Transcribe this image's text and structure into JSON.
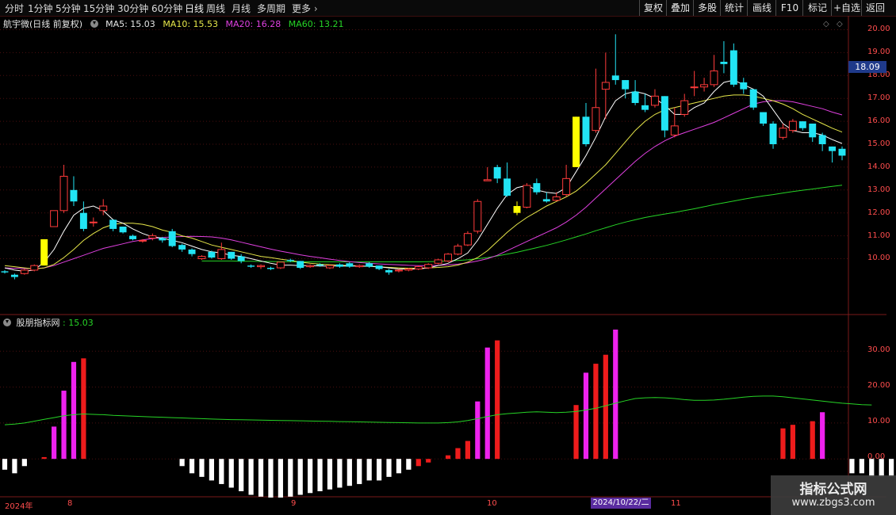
{
  "toolbar": {
    "periods": [
      "分时",
      "1分钟",
      "5分钟",
      "15分钟",
      "30分钟",
      "60分钟",
      "日线",
      "周线",
      "月线",
      "多周期",
      "更多"
    ],
    "active_period": "日线",
    "tools": [
      "复权",
      "叠加",
      "多股",
      "统计",
      "画线",
      "F10",
      "标记",
      "+自选",
      "返回"
    ]
  },
  "main_chart": {
    "stock_label": "航宇微(日线 前复权)",
    "ma5": "MA5: 15.03",
    "ma10": "MA10: 15.53",
    "ma20": "MA20: 16.28",
    "ma60": "MA60: 13.21",
    "current_price_tag": "18.09",
    "y_labels": [
      "20.00",
      "19.00",
      "18.00",
      "17.00",
      "16.00",
      "15.00",
      "14.00",
      "13.00",
      "12.00",
      "11.00",
      "10.00"
    ],
    "colors": {
      "up": "#ff3b3b",
      "down": "#22e4f4",
      "ma5": "#ffffff",
      "ma10": "#e8e84a",
      "ma20": "#e040e0",
      "ma60": "#26d426",
      "highlight": "#ffff00"
    }
  },
  "indicator": {
    "name": "股朋指标网",
    "value": ": 15.03",
    "y_labels": [
      "30.00",
      "20.00",
      "10.00",
      "0.00"
    ]
  },
  "date_axis": {
    "labels": [
      "2024年",
      "8",
      "9",
      "10",
      "11"
    ],
    "highlighted": "2024/10/22/二"
  },
  "watermark": {
    "title": "指标公式网",
    "url": "www.zbgs3.com"
  },
  "chart_data": {
    "type": "candlestick",
    "title": "航宇微(日线 前复权)",
    "y_range": [
      9.0,
      20.3
    ],
    "candles": [
      [
        9.45,
        9.4,
        9.5,
        9.35
      ],
      [
        9.3,
        9.2,
        9.35,
        9.1
      ],
      [
        9.35,
        9.5,
        9.55,
        9.3
      ],
      [
        9.5,
        9.7,
        9.75,
        9.45
      ],
      [
        9.7,
        10.85,
        10.85,
        9.7
      ],
      [
        11.4,
        12.1,
        12.1,
        11.4
      ],
      [
        12.1,
        13.6,
        14.1,
        12.0
      ],
      [
        13.0,
        12.5,
        13.6,
        12.3
      ],
      [
        12.0,
        11.3,
        12.5,
        11.2
      ],
      [
        11.6,
        11.6,
        11.8,
        11.4
      ],
      [
        12.1,
        12.3,
        12.6,
        11.9
      ],
      [
        11.7,
        11.3,
        11.7,
        11.2
      ],
      [
        11.4,
        11.15,
        11.4,
        11.1
      ],
      [
        11.0,
        10.85,
        11.05,
        10.8
      ],
      [
        10.8,
        10.8,
        10.85,
        10.7
      ],
      [
        10.9,
        11.0,
        11.1,
        10.8
      ],
      [
        10.9,
        10.8,
        10.95,
        10.7
      ],
      [
        11.2,
        10.55,
        11.3,
        10.5
      ],
      [
        10.6,
        10.4,
        10.65,
        10.3
      ],
      [
        10.4,
        10.2,
        10.45,
        10.1
      ],
      [
        10.0,
        10.1,
        10.15,
        9.95
      ],
      [
        10.3,
        10.05,
        10.35,
        10.0
      ],
      [
        10.0,
        10.4,
        10.7,
        9.95
      ],
      [
        10.3,
        10.0,
        10.3,
        9.95
      ],
      [
        10.1,
        9.9,
        10.2,
        9.8
      ],
      [
        9.7,
        9.65,
        9.75,
        9.6
      ],
      [
        9.65,
        9.7,
        9.75,
        9.55
      ],
      [
        9.6,
        9.55,
        9.65,
        9.5
      ],
      [
        9.6,
        9.85,
        9.85,
        9.55
      ],
      [
        9.95,
        9.9,
        10.0,
        9.85
      ],
      [
        9.9,
        9.6,
        9.9,
        9.55
      ],
      [
        9.65,
        9.7,
        9.75,
        9.6
      ],
      [
        9.75,
        9.7,
        9.8,
        9.65
      ],
      [
        9.6,
        9.7,
        9.75,
        9.55
      ],
      [
        9.75,
        9.65,
        9.8,
        9.6
      ],
      [
        9.8,
        9.65,
        9.85,
        9.6
      ],
      [
        9.65,
        9.7,
        9.75,
        9.6
      ],
      [
        9.8,
        9.65,
        9.85,
        9.6
      ],
      [
        9.7,
        9.55,
        9.7,
        9.5
      ],
      [
        9.5,
        9.4,
        9.55,
        9.3
      ],
      [
        9.5,
        9.5,
        9.55,
        9.4
      ],
      [
        9.5,
        9.55,
        9.6,
        9.45
      ],
      [
        9.55,
        9.65,
        9.7,
        9.5
      ],
      [
        9.6,
        9.75,
        9.8,
        9.55
      ],
      [
        9.8,
        9.95,
        10.0,
        9.75
      ],
      [
        9.9,
        10.2,
        10.25,
        9.85
      ],
      [
        10.2,
        10.55,
        10.65,
        10.15
      ],
      [
        10.6,
        11.1,
        11.2,
        10.55
      ],
      [
        11.2,
        12.5,
        12.6,
        11.1
      ],
      [
        13.4,
        13.45,
        14.0,
        13.4
      ],
      [
        14.0,
        13.5,
        14.1,
        13.3
      ],
      [
        13.5,
        12.75,
        14.2,
        12.7
      ],
      [
        12.3,
        12.0,
        12.5,
        11.9
      ],
      [
        12.25,
        13.2,
        13.3,
        12.2
      ],
      [
        13.3,
        12.9,
        13.5,
        12.8
      ],
      [
        12.6,
        12.5,
        12.9,
        12.45
      ],
      [
        12.55,
        12.7,
        12.9,
        12.5
      ],
      [
        12.8,
        13.5,
        14.1,
        12.7
      ],
      [
        14.0,
        16.2,
        16.2,
        14.0
      ],
      [
        16.2,
        15.0,
        16.8,
        14.9
      ],
      [
        15.6,
        16.6,
        18.3,
        15.5
      ],
      [
        17.4,
        17.7,
        19.0,
        16.1
      ],
      [
        18.0,
        17.8,
        19.8,
        17.6
      ],
      [
        17.8,
        17.4,
        17.8,
        17.0
      ],
      [
        17.3,
        16.8,
        17.8,
        16.7
      ],
      [
        16.7,
        16.5,
        17.2,
        16.4
      ],
      [
        16.7,
        17.1,
        17.4,
        16.6
      ],
      [
        17.1,
        15.6,
        17.1,
        15.3
      ],
      [
        15.4,
        15.8,
        16.6,
        15.3
      ],
      [
        16.3,
        16.9,
        17.2,
        16.2
      ],
      [
        17.5,
        17.5,
        18.2,
        17.1
      ],
      [
        17.5,
        17.6,
        17.9,
        17.3
      ],
      [
        17.6,
        18.2,
        18.9,
        17.5
      ],
      [
        18.6,
        18.5,
        19.5,
        18.1
      ],
      [
        19.1,
        17.6,
        19.4,
        17.5
      ],
      [
        17.7,
        17.4,
        17.9,
        17.2
      ],
      [
        17.4,
        16.6,
        17.4,
        16.5
      ],
      [
        16.4,
        15.9,
        16.4,
        15.8
      ],
      [
        15.9,
        15.0,
        16.0,
        14.8
      ],
      [
        15.3,
        15.7,
        15.9,
        15.2
      ],
      [
        15.6,
        16.0,
        16.1,
        15.5
      ],
      [
        16.0,
        15.7,
        16.0,
        15.6
      ],
      [
        15.9,
        15.3,
        15.9,
        15.1
      ],
      [
        15.4,
        15.0,
        15.5,
        14.7
      ],
      [
        14.9,
        14.7,
        14.9,
        14.2
      ],
      [
        14.8,
        14.5,
        14.9,
        14.3
      ]
    ],
    "highlight_bars": [
      4,
      52,
      58
    ],
    "ma5": [
      9.6,
      9.5,
      9.45,
      9.5,
      9.85,
      10.4,
      11.2,
      11.9,
      12.2,
      12.3,
      12.1,
      11.7,
      11.55,
      11.3,
      11.1,
      10.95,
      10.9,
      10.8,
      10.7,
      10.55,
      10.4,
      10.3,
      10.25,
      10.15,
      10.1,
      10.0,
      9.9,
      9.8,
      9.72,
      9.72,
      9.7,
      9.7,
      9.68,
      9.68,
      9.68,
      9.68,
      9.68,
      9.67,
      9.65,
      9.6,
      9.55,
      9.55,
      9.55,
      9.6,
      9.7,
      9.8,
      10.0,
      10.25,
      10.8,
      11.5,
      12.2,
      12.8,
      13.1,
      13.2,
      13.0,
      12.9,
      12.85,
      13.1,
      13.8,
      14.5,
      15.3,
      16.2,
      16.9,
      17.2,
      17.3,
      17.2,
      17.0,
      16.7,
      16.3,
      16.3,
      16.6,
      16.8,
      17.3,
      17.7,
      17.8,
      17.6,
      17.4,
      17.1,
      16.5,
      15.9,
      15.6,
      15.5,
      15.5,
      15.4,
      15.2,
      15.03
    ],
    "ma10": [
      9.7,
      9.65,
      9.6,
      9.55,
      9.6,
      9.75,
      10.05,
      10.4,
      10.8,
      11.1,
      11.35,
      11.5,
      11.55,
      11.55,
      11.5,
      11.4,
      11.25,
      11.15,
      11.0,
      10.9,
      10.75,
      10.6,
      10.5,
      10.4,
      10.3,
      10.2,
      10.1,
      10.05,
      9.98,
      9.92,
      9.85,
      9.8,
      9.76,
      9.74,
      9.72,
      9.7,
      9.68,
      9.66,
      9.64,
      9.62,
      9.6,
      9.58,
      9.58,
      9.6,
      9.62,
      9.65,
      9.72,
      9.85,
      10.05,
      10.35,
      10.75,
      11.15,
      11.5,
      11.8,
      12.05,
      12.3,
      12.5,
      12.7,
      12.95,
      13.3,
      13.7,
      14.1,
      14.6,
      15.1,
      15.6,
      16.0,
      16.3,
      16.5,
      16.6,
      16.7,
      16.8,
      16.9,
      17.0,
      17.1,
      17.15,
      17.15,
      17.1,
      17.0,
      16.9,
      16.75,
      16.55,
      16.3,
      16.1,
      15.9,
      15.7,
      15.53
    ],
    "ma20": [
      9.6,
      9.58,
      9.57,
      9.56,
      9.6,
      9.7,
      9.85,
      10.0,
      10.15,
      10.3,
      10.45,
      10.55,
      10.65,
      10.75,
      10.82,
      10.88,
      10.92,
      10.95,
      10.97,
      10.98,
      10.97,
      10.95,
      10.9,
      10.82,
      10.72,
      10.62,
      10.52,
      10.42,
      10.33,
      10.25,
      10.17,
      10.1,
      10.04,
      9.98,
      9.92,
      9.87,
      9.83,
      9.8,
      9.77,
      9.75,
      9.73,
      9.71,
      9.7,
      9.7,
      9.71,
      9.73,
      9.76,
      9.82,
      9.9,
      10.0,
      10.15,
      10.35,
      10.55,
      10.75,
      10.95,
      11.15,
      11.35,
      11.6,
      11.9,
      12.25,
      12.65,
      13.05,
      13.45,
      13.85,
      14.25,
      14.6,
      14.9,
      15.15,
      15.35,
      15.5,
      15.65,
      15.8,
      15.95,
      16.15,
      16.35,
      16.55,
      16.75,
      16.85,
      16.9,
      16.9,
      16.85,
      16.75,
      16.65,
      16.55,
      16.4,
      16.28
    ],
    "ma60": [
      null,
      null,
      null,
      null,
      null,
      null,
      null,
      null,
      null,
      null,
      null,
      null,
      null,
      null,
      null,
      null,
      null,
      null,
      null,
      null,
      9.9,
      9.9,
      9.9,
      9.9,
      9.89,
      9.89,
      9.88,
      9.88,
      9.87,
      9.87,
      9.86,
      9.86,
      9.86,
      9.86,
      9.86,
      9.86,
      9.86,
      9.86,
      9.86,
      9.86,
      9.86,
      9.86,
      9.86,
      9.87,
      9.88,
      9.9,
      9.92,
      9.95,
      10.0,
      10.05,
      10.12,
      10.2,
      10.28,
      10.38,
      10.48,
      10.58,
      10.7,
      10.82,
      10.95,
      11.08,
      11.22,
      11.35,
      11.48,
      11.6,
      11.7,
      11.8,
      11.88,
      11.95,
      12.02,
      12.1,
      12.18,
      12.27,
      12.36,
      12.44,
      12.52,
      12.6,
      12.67,
      12.74,
      12.8,
      12.87,
      12.93,
      12.99,
      13.04,
      13.1,
      13.16,
      13.21
    ],
    "indicator_bars": [
      -3,
      -4,
      -2,
      0,
      0.5,
      9,
      19,
      27,
      28,
      0,
      0,
      0,
      0,
      0,
      0,
      0,
      0,
      0,
      -2,
      -4,
      -5,
      -6,
      -7,
      -8,
      -9,
      -10,
      -10.5,
      -11,
      -11,
      -10.5,
      -10,
      -9.5,
      -9,
      -8.5,
      -8,
      -7.5,
      -7,
      -6,
      -6,
      -5,
      -4,
      -3,
      -2,
      -1,
      0,
      1,
      3,
      5,
      16,
      31,
      33,
      0,
      0,
      0,
      0,
      0,
      0,
      0,
      15,
      24,
      26.5,
      29,
      36,
      0,
      0,
      0,
      0,
      0,
      0,
      0,
      0,
      0,
      0,
      0,
      0,
      0,
      0,
      0,
      0,
      8.5,
      9.5,
      0,
      10.5,
      13,
      0,
      0,
      -4,
      -4,
      -5,
      -5,
      -5,
      -5
    ],
    "indicator_bar_colors": [
      "w",
      "w",
      "w",
      "r",
      "r",
      "m",
      "m",
      "m",
      "r",
      "n",
      "n",
      "n",
      "n",
      "n",
      "n",
      "n",
      "n",
      "n",
      "w",
      "w",
      "w",
      "w",
      "w",
      "w",
      "w",
      "w",
      "w",
      "w",
      "w",
      "w",
      "w",
      "w",
      "w",
      "w",
      "w",
      "w",
      "w",
      "w",
      "w",
      "w",
      "w",
      "w",
      "r",
      "r",
      "r",
      "r",
      "r",
      "r",
      "m",
      "m",
      "r",
      "n",
      "n",
      "n",
      "n",
      "n",
      "n",
      "n",
      "r",
      "m",
      "r",
      "r",
      "m",
      "n",
      "n",
      "n",
      "n",
      "n",
      "n",
      "n",
      "n",
      "n",
      "n",
      "n",
      "n",
      "n",
      "n",
      "n",
      "n",
      "r",
      "r",
      "n",
      "r",
      "m",
      "n",
      "n",
      "w",
      "w",
      "w",
      "w",
      "w",
      "w"
    ],
    "indicator_line": [
      9.5,
      9.7,
      10.0,
      10.5,
      11.0,
      11.5,
      12.0,
      12.3,
      12.5,
      12.4,
      12.3,
      12.1,
      12.0,
      11.9,
      11.8,
      11.7,
      11.6,
      11.5,
      11.4,
      11.3,
      11.2,
      11.1,
      11.0,
      10.95,
      10.9,
      10.85,
      10.8,
      10.75,
      10.7,
      10.65,
      10.6,
      10.55,
      10.5,
      10.45,
      10.4,
      10.35,
      10.3,
      10.25,
      10.2,
      10.15,
      10.1,
      10.05,
      10.0,
      10.0,
      10.0,
      10.1,
      10.3,
      10.7,
      11.2,
      11.8,
      12.3,
      12.6,
      12.8,
      13.0,
      13.1,
      13.0,
      12.9,
      13.0,
      13.2,
      13.6,
      14.1,
      14.8,
      15.5,
      16.2,
      16.8,
      17.0,
      17.1,
      17.0,
      16.8,
      16.5,
      16.3,
      16.3,
      16.4,
      16.6,
      16.9,
      17.2,
      17.4,
      17.5,
      17.5,
      17.3,
      17.0,
      16.7,
      16.4,
      16.1,
      15.8,
      15.5,
      15.3,
      15.1,
      15.03
    ],
    "indicator_y_range": [
      -9,
      36
    ]
  }
}
